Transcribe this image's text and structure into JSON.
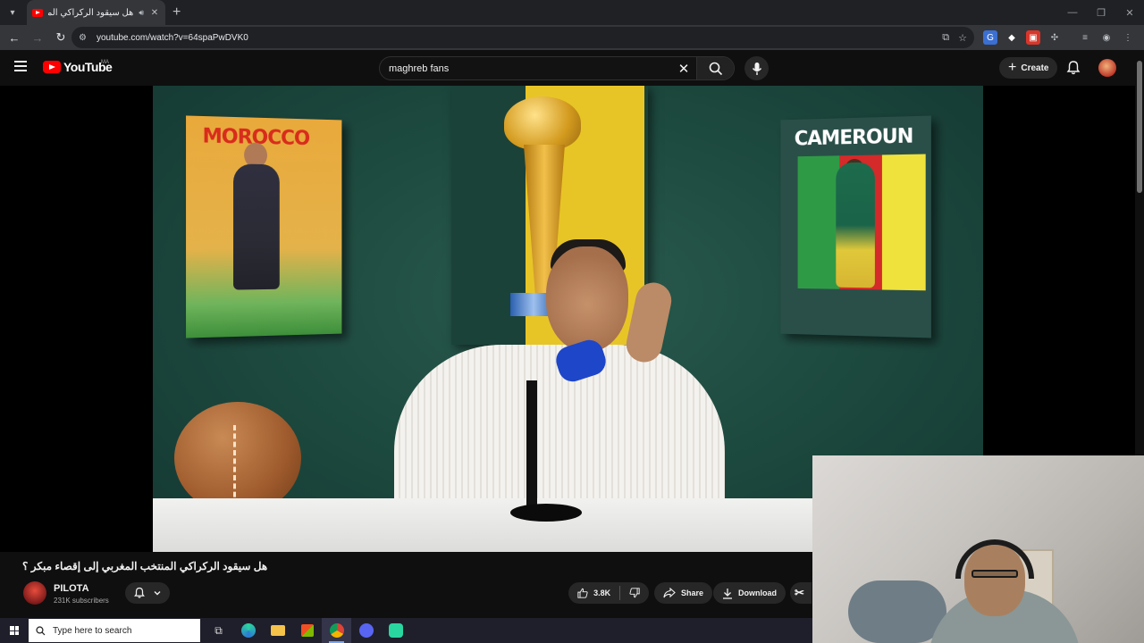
{
  "browser": {
    "tab_title": "هل سيقود الركراكي المنتخ",
    "tab_close": "✕",
    "new_tab": "+",
    "url": "youtube.com/watch?v=64spaPwDVK0"
  },
  "youtube": {
    "logo_text": "YouTube",
    "region": "MA",
    "search_value": "maghreb fans",
    "create_label": "Create"
  },
  "video": {
    "title": "هل سيقود الركراكي المنتخب المغربي إلى إقصاء مبكر ؟",
    "poster_left_text": "MOROCCO",
    "poster_right_text": "CAMEROUN",
    "channel_name": "PILOTA",
    "subscribers": "231K subscribers",
    "likes": "3.8K",
    "share_label": "Share",
    "download_label": "Download"
  },
  "taskbar": {
    "search_placeholder": "Type here to search"
  },
  "colors": {
    "yt_red": "#ff0000",
    "background": "#0f0f0f",
    "mic_blue": "#1e46c9"
  }
}
